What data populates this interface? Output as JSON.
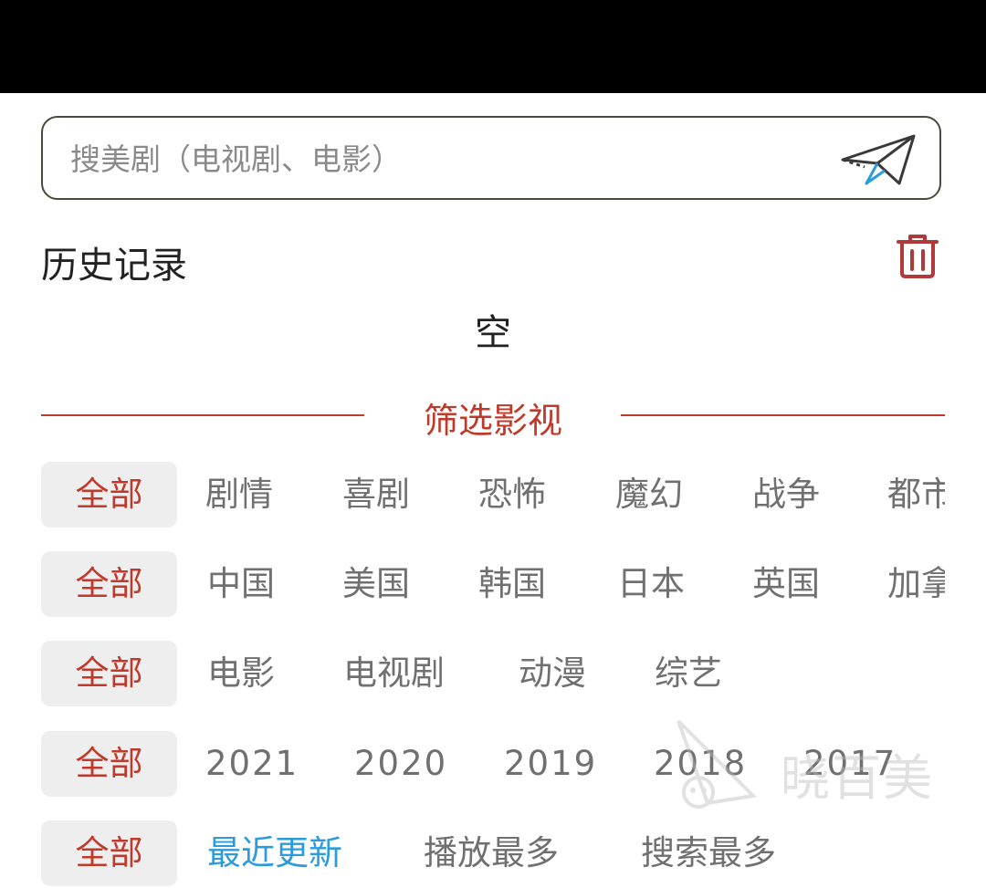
{
  "search": {
    "placeholder": "搜美剧（电视剧、电影）",
    "value": ""
  },
  "history": {
    "title": "历史记录",
    "empty_text": "空"
  },
  "filter": {
    "title": "筛选影视"
  },
  "rows": [
    {
      "all": "全部",
      "items": [
        "剧情",
        "喜剧",
        "恐怖",
        "魔幻",
        "战争",
        "都市"
      ]
    },
    {
      "all": "全部",
      "items": [
        "中国",
        "美国",
        "韩国",
        "日本",
        "英国",
        "加拿大"
      ]
    },
    {
      "all": "全部",
      "items": [
        "电影",
        "电视剧",
        "动漫",
        "综艺"
      ]
    },
    {
      "all": "全部",
      "items": [
        "2021",
        "2020",
        "2019",
        "2018",
        "2017"
      ]
    },
    {
      "all": "全部",
      "items": [
        "最近更新",
        "播放最多",
        "搜索最多"
      ]
    }
  ],
  "watermark": {
    "text": "晓百美"
  },
  "colors": {
    "accent": "#c0392b",
    "link_blue": "#2a9bdc",
    "chip_bg": "#eeeeee",
    "text_gray": "#707070"
  },
  "icons": {
    "send": "paper-plane-icon",
    "delete": "trash-icon"
  }
}
